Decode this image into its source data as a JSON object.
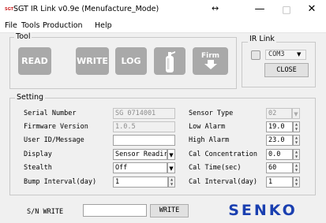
{
  "window": {
    "icon_text": "SGT",
    "title": "SGT IR Link v0.9e (Menufacture_Mode)",
    "resize_glyph": "↔",
    "min_glyph": "—",
    "max_glyph": "□",
    "close_glyph": "✕"
  },
  "menu": {
    "file": "File",
    "tools": "Tools",
    "production": "Production",
    "help": "Help"
  },
  "tool": {
    "label": "Tool",
    "read": "READ",
    "write": "WRITE",
    "log": "LOG",
    "firm": "Firm",
    "sensor_icon": "gas-cylinder-icon"
  },
  "ir_link": {
    "label": "IR Link",
    "com_port": "COM3",
    "close": "CLOSE"
  },
  "setting": {
    "label": "Setting",
    "serial_number_label": "Serial Number",
    "serial_number": "SG 0714001",
    "firmware_label": "Firmware Version",
    "firmware": "1.0.5",
    "user_id_label": "User ID/Message",
    "user_id": "",
    "display_label": "Display",
    "display": "Sensor Readir",
    "stealth_label": "Stealth",
    "stealth": "Off",
    "bump_label": "Bump Interval(day)",
    "bump": "1",
    "sensor_type_label": "Sensor Type",
    "sensor_type": "02",
    "low_alarm_label": "Low Alarm",
    "low_alarm": "19.0",
    "high_alarm_label": "High Alarm",
    "high_alarm": "23.0",
    "cal_conc_label": "Cal Concentration",
    "cal_conc": "0.0",
    "cal_time_label": "Cal Time(sec)",
    "cal_time": "60",
    "cal_interval_label": "Cal Interval(day)",
    "cal_interval": "1"
  },
  "sn_write": {
    "label": "S/N WRITE",
    "value": "",
    "button": "WRITE"
  },
  "logo": {
    "text": "SENKO",
    "color": "#1a3fb0"
  },
  "colors": {
    "tool_button": "#a9a9a9",
    "background": "#f0f0f0"
  }
}
